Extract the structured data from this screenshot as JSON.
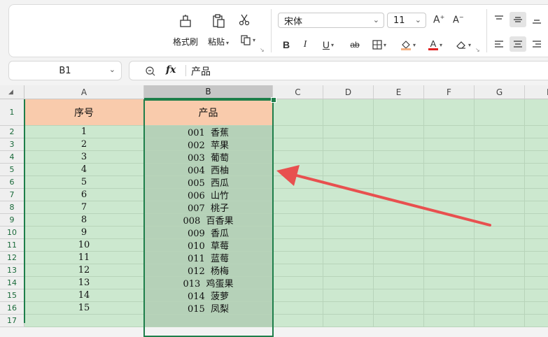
{
  "clipboard": {
    "format_painter_label": "格式刷",
    "paste_label": "粘贴"
  },
  "font": {
    "name": "宋体",
    "size": "11"
  },
  "formula_bar": {
    "cell_ref": "B1",
    "fx_label": "fx",
    "content": "产品"
  },
  "columns": [
    "A",
    "B",
    "C",
    "D",
    "E",
    "F",
    "G",
    "H"
  ],
  "selected_column": "B",
  "header_row": {
    "a": "序号",
    "b": "产品"
  },
  "rows": [
    {
      "a": "1",
      "b": "001  香蕉"
    },
    {
      "a": "2",
      "b": "002  苹果"
    },
    {
      "a": "3",
      "b": "003  葡萄"
    },
    {
      "a": "4",
      "b": "004  西柚"
    },
    {
      "a": "5",
      "b": "005  西瓜"
    },
    {
      "a": "6",
      "b": "006  山竹"
    },
    {
      "a": "7",
      "b": "007  桃子"
    },
    {
      "a": "8",
      "b": "008  百香果"
    },
    {
      "a": "9",
      "b": "009  香瓜"
    },
    {
      "a": "10",
      "b": "010  草莓"
    },
    {
      "a": "11",
      "b": "011  蓝莓"
    },
    {
      "a": "12",
      "b": "012  杨梅"
    },
    {
      "a": "13",
      "b": "013  鸡蛋果"
    },
    {
      "a": "14",
      "b": "014  菠萝"
    },
    {
      "a": "15",
      "b": "015  凤梨"
    }
  ],
  "row_numbers": [
    "1",
    "2",
    "3",
    "4",
    "5",
    "6",
    "7",
    "8",
    "9",
    "10",
    "11",
    "12",
    "13",
    "14",
    "15",
    "16",
    "17"
  ],
  "colors": {
    "sheet_bg": "#cce8cf",
    "header_fill": "#f9cbac",
    "selection": "#1e7e4a",
    "arrow": "#e8504f"
  }
}
